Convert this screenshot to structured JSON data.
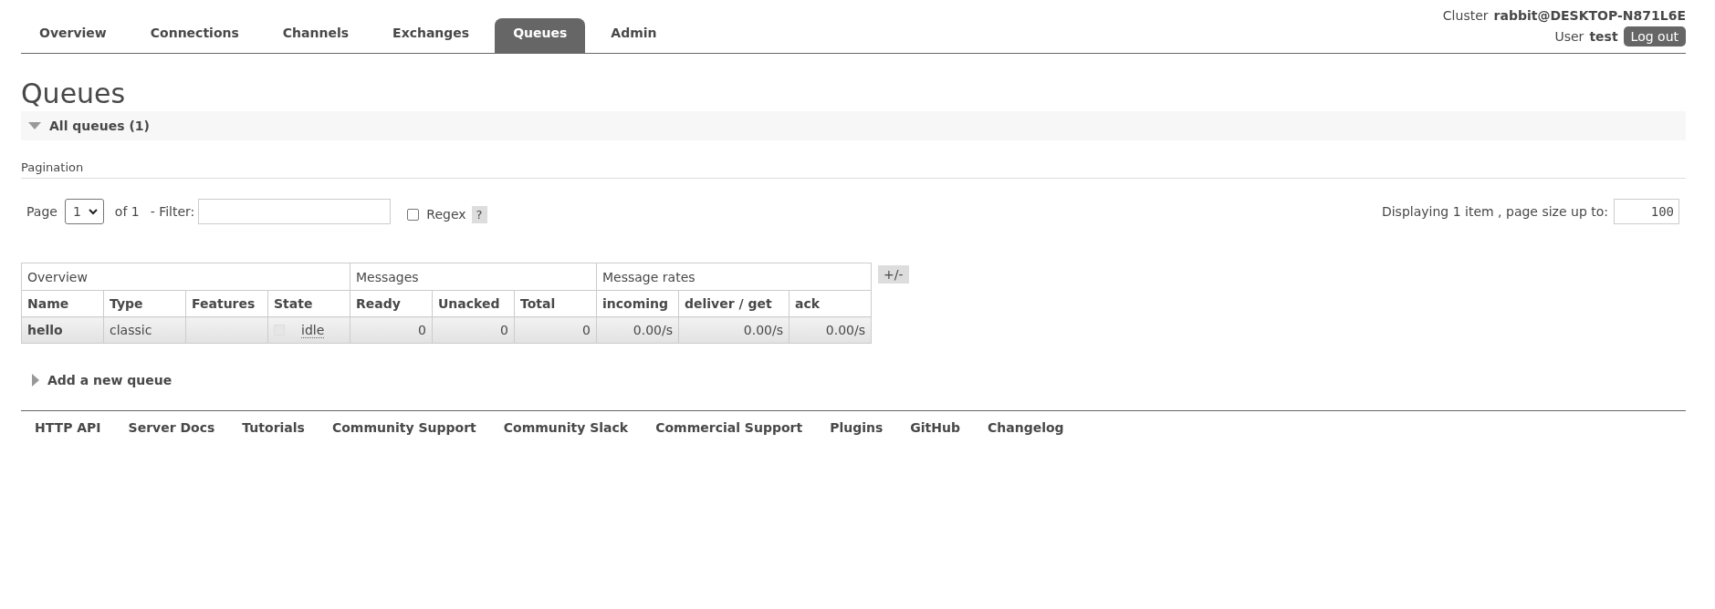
{
  "header": {
    "cluster_label": "Cluster",
    "cluster_name": "rabbit@DESKTOP-N871L6E",
    "user_label": "User",
    "user_name": "test",
    "logout": "Log out"
  },
  "tabs": [
    {
      "label": "Overview",
      "selected": false
    },
    {
      "label": "Connections",
      "selected": false
    },
    {
      "label": "Channels",
      "selected": false
    },
    {
      "label": "Exchanges",
      "selected": false
    },
    {
      "label": "Queues",
      "selected": true
    },
    {
      "label": "Admin",
      "selected": false
    }
  ],
  "page_title": "Queues",
  "all_queues": {
    "label": "All queues (1)",
    "expanded": true
  },
  "pagination": {
    "title": "Pagination",
    "page_label": "Page",
    "page": "1",
    "of": "of 1",
    "filter_label": "- Filter:",
    "regex_label": "Regex",
    "regex_checked": false,
    "help": "?",
    "displaying": "Displaying 1 item , page size up to:",
    "page_size": "100"
  },
  "table": {
    "groups": [
      {
        "label": "Overview",
        "columns": [
          "Name",
          "Type",
          "Features",
          "State"
        ]
      },
      {
        "label": "Messages",
        "columns": [
          "Ready",
          "Unacked",
          "Total"
        ]
      },
      {
        "label": "Message rates",
        "columns": [
          "incoming",
          "deliver / get",
          "ack"
        ]
      }
    ],
    "toggle": "+/-",
    "rows": [
      {
        "name": "hello",
        "type": "classic",
        "state": "idle",
        "ready": "0",
        "unacked": "0",
        "total": "0",
        "incoming": "0.00/s",
        "deliver_get": "0.00/s",
        "ack": "0.00/s"
      }
    ]
  },
  "add_queue": {
    "label": "Add a new queue",
    "expanded": false
  },
  "footer_links": [
    "HTTP API",
    "Server Docs",
    "Tutorials",
    "Community Support",
    "Community Slack",
    "Commercial Support",
    "Plugins",
    "GitHub",
    "Changelog"
  ]
}
